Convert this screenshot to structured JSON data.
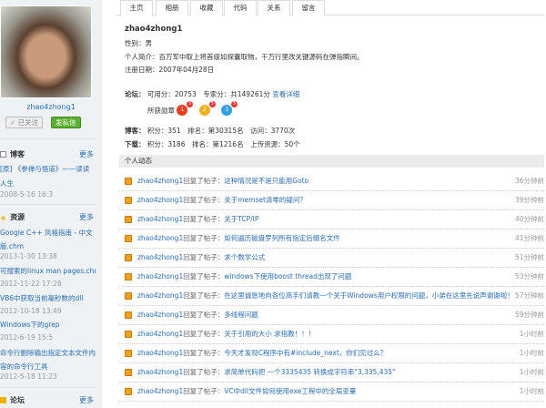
{
  "sidebar": {
    "username": "zhao4zhong1",
    "followed_label": "✓ 已关注",
    "message_label": "发私信",
    "blog": {
      "title": "博客",
      "more": "更多",
      "items": [
        {
          "title": "[原] 《参禅与悟道》——读读人生",
          "date": "2008-5-16 16:3"
        }
      ]
    },
    "resources": {
      "title": "资源",
      "more": "更多",
      "items": [
        {
          "title": "Google C++ 风格指南 - 中文版.chm",
          "date": "2013-1-30 13:38"
        },
        {
          "title": "可搜索的linux man pages.chm",
          "date": "2012-11-22 17:28"
        },
        {
          "title": "VB6中获取当前毫秒数的dll",
          "date": "2012-10-18 13:49"
        },
        {
          "title": "Windows下的grep",
          "date": "2012-6-19 15:5"
        },
        {
          "title": "命令行删除输出指定文本文件内容的命令行工具",
          "date": "2012-5-18 11:23"
        }
      ]
    },
    "forum": {
      "title": "论坛",
      "more": "更多"
    }
  },
  "tabs": [
    "主页",
    "相册",
    "收藏",
    "代码",
    "关系",
    "留言"
  ],
  "profile": {
    "name": "zhao4zhong1",
    "gender": "性别：男",
    "intro": "个人简介：百万军中取上将首级如探囊取物，千万行里改关键源码在弹指瞬间。",
    "reg": "注册日期：2007年04月28日",
    "forum_label": "论坛：",
    "forum_points": "可用分：20753",
    "forum_expert": "专家分：共149261分",
    "forum_detail": "查看详细",
    "medals_label": "所获勋章",
    "medals": [
      {
        "rank": "1",
        "count": "5",
        "color": "#e84020"
      },
      {
        "rank": "2",
        "count": "5",
        "color": "#f0b020"
      },
      {
        "rank": "3",
        "count": "5",
        "color": "#30a0e0"
      }
    ],
    "blog_label": "博客：",
    "blog_stats": "积分：351　排名：第30315名　访问：3770次",
    "download_label": "下载：",
    "download_stats": "积分：3186　排名：第1216名　上传资源：50个"
  },
  "activity": {
    "title": "个人动态",
    "user": "zhao4zhong1",
    "action": "回复了帖子：",
    "items": [
      {
        "title": "这种情况是不是只能用Goto",
        "time": "36分钟前"
      },
      {
        "title": "关于memset清零的疑问？",
        "time": "39分钟前"
      },
      {
        "title": "关于TCP/IP",
        "time": "40分钟前"
      },
      {
        "title": "如何遍历磁盘罗列所有指定后缀名文件",
        "time": "41分钟前"
      },
      {
        "title": "求个数学公式",
        "time": "51分钟前"
      },
      {
        "title": "windows下使用boost thread出现了问题",
        "time": "53分钟前"
      },
      {
        "title": "在这里诚恳地向各位高手们请教一个关于Windows用户权限的问题，小弟在这里先说声谢谢啦！",
        "time": "57分钟前"
      },
      {
        "title": "多线程问题",
        "time": "59分钟前"
      },
      {
        "title": "关于引用的大小 求指教！！！",
        "time": "1小时前"
      },
      {
        "title": "今天才发现C程序中有#include_next，你们见过么？",
        "time": "1小时前"
      },
      {
        "title": "求简单代码把 一个3335435 转换成字符串\"3,335,435\"",
        "time": "1小时前"
      },
      {
        "title": "VC中dll文件如何使用exe工程中的全局变量",
        "time": "1小时前"
      }
    ]
  }
}
